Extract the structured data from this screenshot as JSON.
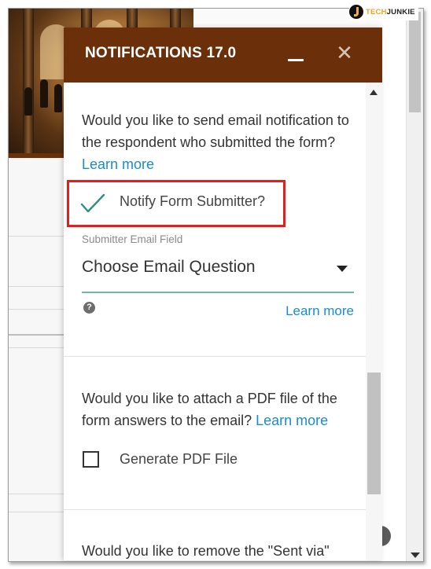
{
  "window": {
    "brand": {
      "part1": "TECH",
      "part2": "JUNKIE"
    }
  },
  "panel": {
    "title": "NOTIFICATIONS 17.0",
    "close_glyph": "✕",
    "email_section": {
      "question": "Would you like to send email notification to the respondent who submitted the form?",
      "learn_more": "Learn more",
      "notify_label": "Notify Form Submitter?",
      "notify_checked": true,
      "field_caption": "Submitter Email Field",
      "select_value": "Choose Email Question",
      "help_glyph": "?",
      "learn_more_right": "Learn more"
    },
    "pdf_section": {
      "question": "Would you like to attach a PDF file of the form answers to the email?",
      "learn_more": "Learn more",
      "pdf_label": "Generate PDF File",
      "pdf_checked": false
    },
    "sent_via_section": {
      "question": "Would you like to remove the \"Sent via\""
    }
  },
  "colors": {
    "header": "#6b3009",
    "link": "#1a8cc9",
    "checkmark": "#2f8f83",
    "highlight": "#e02020",
    "select_underline": "#6fb6a8"
  },
  "icons": {
    "checkmark": "checkmark-icon",
    "minimize": "minimize-icon",
    "close": "close-icon",
    "dropdown": "caret-down-icon",
    "help": "question-circle-icon"
  }
}
